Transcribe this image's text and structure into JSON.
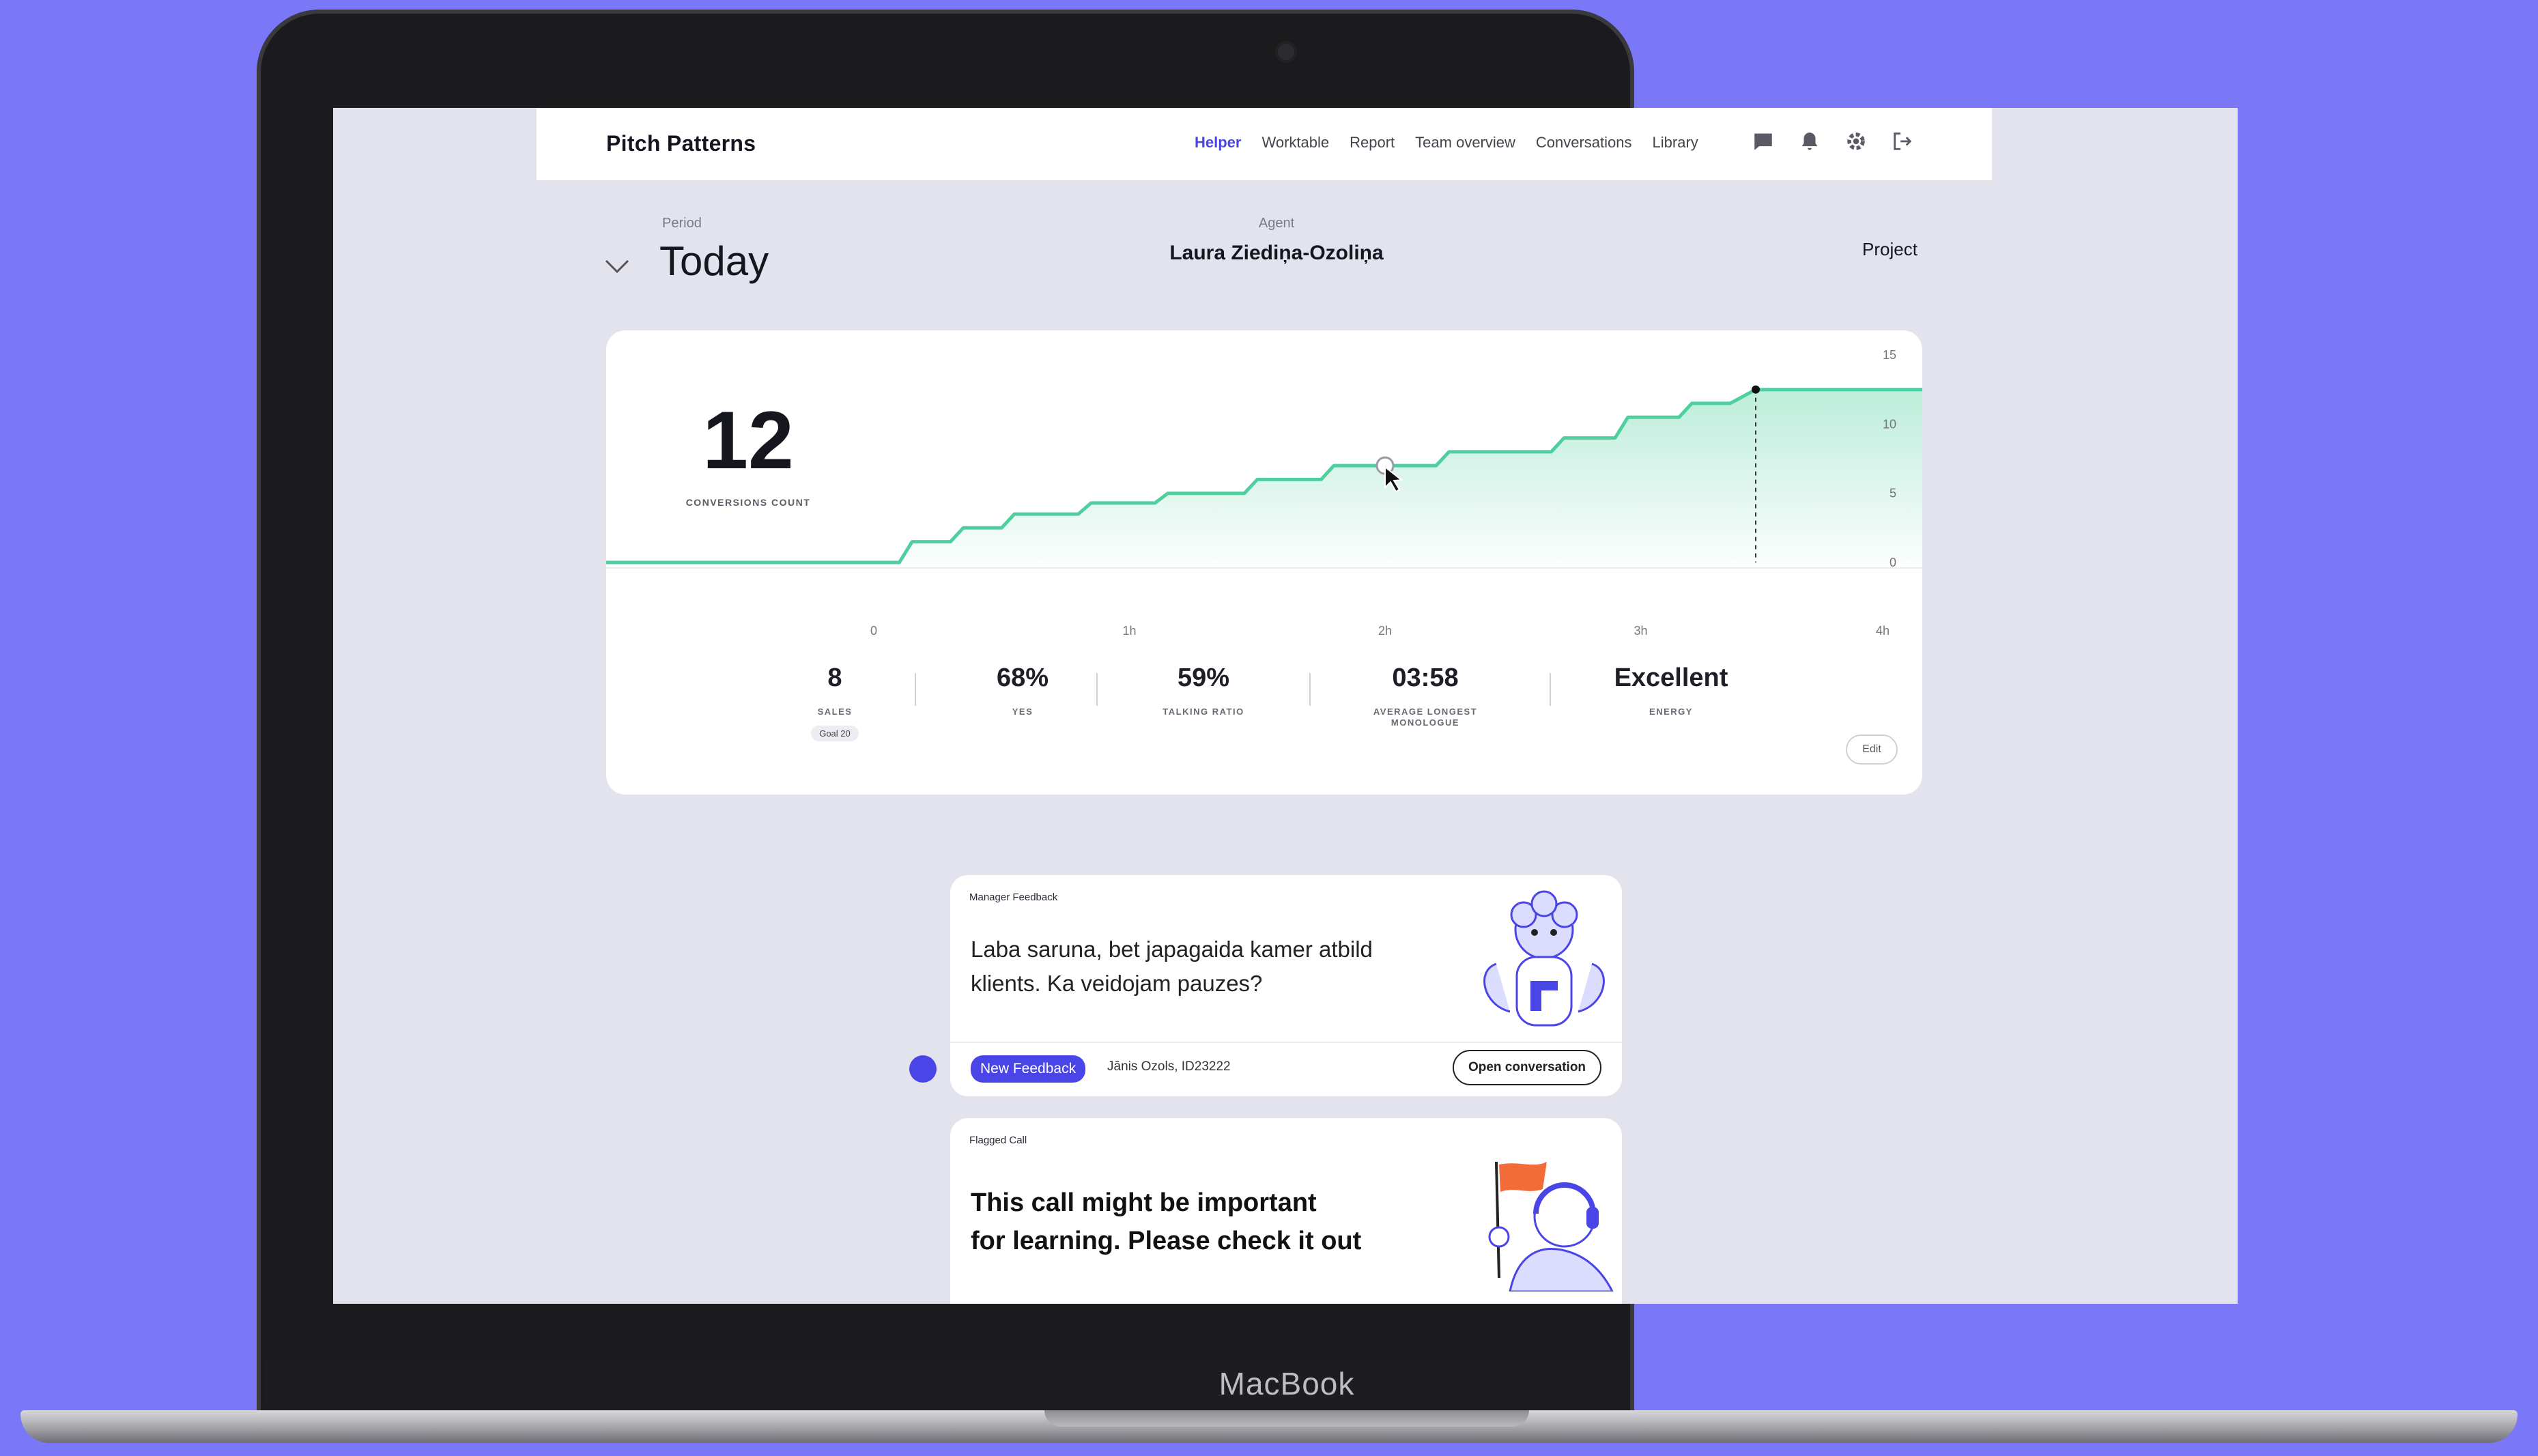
{
  "app": {
    "logo": "Pitch Patterns",
    "nav": [
      "Helper",
      "Worktable",
      "Report",
      "Team overview",
      "Conversations",
      "Library"
    ],
    "active_nav": "Helper",
    "icons": [
      "chat-icon",
      "bell-icon",
      "gear-icon",
      "logout-icon"
    ],
    "accent": "#4a45e6"
  },
  "filters": {
    "period_label": "Period",
    "period_value": "Today",
    "agent_label": "Agent",
    "agent_value": "Laura Ziediņa-Ozoliņa",
    "project_label": "Project"
  },
  "summary": {
    "count": "12",
    "count_label": "CONVERSIONS COUNT"
  },
  "chart_data": {
    "type": "area",
    "x_ticks": [
      "0",
      "1h",
      "2h",
      "3h",
      "4h"
    ],
    "y_ticks": [
      "0",
      "5",
      "10",
      "15"
    ],
    "xlim": [
      0,
      4
    ],
    "ylim": [
      0,
      15
    ],
    "x": [
      0,
      0.1,
      0.15,
      0.3,
      0.35,
      0.5,
      0.55,
      0.8,
      0.85,
      1.1,
      1.15,
      1.45,
      1.5,
      1.75,
      1.8,
      2.2,
      2.25,
      2.65,
      2.7,
      2.9,
      2.95,
      3.15,
      3.2,
      3.35,
      3.45,
      4.0
    ],
    "y": [
      0,
      0,
      1.5,
      1.5,
      2.5,
      2.5,
      3.5,
      3.5,
      4.3,
      4.3,
      5,
      5,
      6,
      6,
      7,
      7,
      8,
      8,
      9,
      9,
      10.5,
      10.5,
      11.5,
      11.5,
      12.5,
      12.5
    ],
    "highlight_point": {
      "x": 2.0,
      "y": 7
    },
    "marker_x": 3.45,
    "color": "#4fcf9f"
  },
  "stats": [
    {
      "value": "8",
      "label": "SALES",
      "goal": "Goal 20"
    },
    {
      "value": "68%",
      "label": "YES"
    },
    {
      "value": "59%",
      "label": "TALKING RATIO"
    },
    {
      "value": "03:58",
      "label": "AVERAGE LONGEST\nMONOLOGUE"
    },
    {
      "value": "Excellent",
      "label": "ENERGY"
    }
  ],
  "edit_label": "Edit",
  "feedback": {
    "tag": "Manager Feedback",
    "message_line1": "Laba saruna, bet japagaida kamer atbild",
    "message_line2": "klients. Ka veidojam pauzes?",
    "badge": "New Feedback",
    "author": "Jānis Ozols, ID23222",
    "button": "Open conversation"
  },
  "flagged": {
    "tag": "Flagged Call",
    "message_line1": "This call might be important",
    "message_line2": "for learning. Please check it out"
  },
  "laptop_brand": "MacBook"
}
